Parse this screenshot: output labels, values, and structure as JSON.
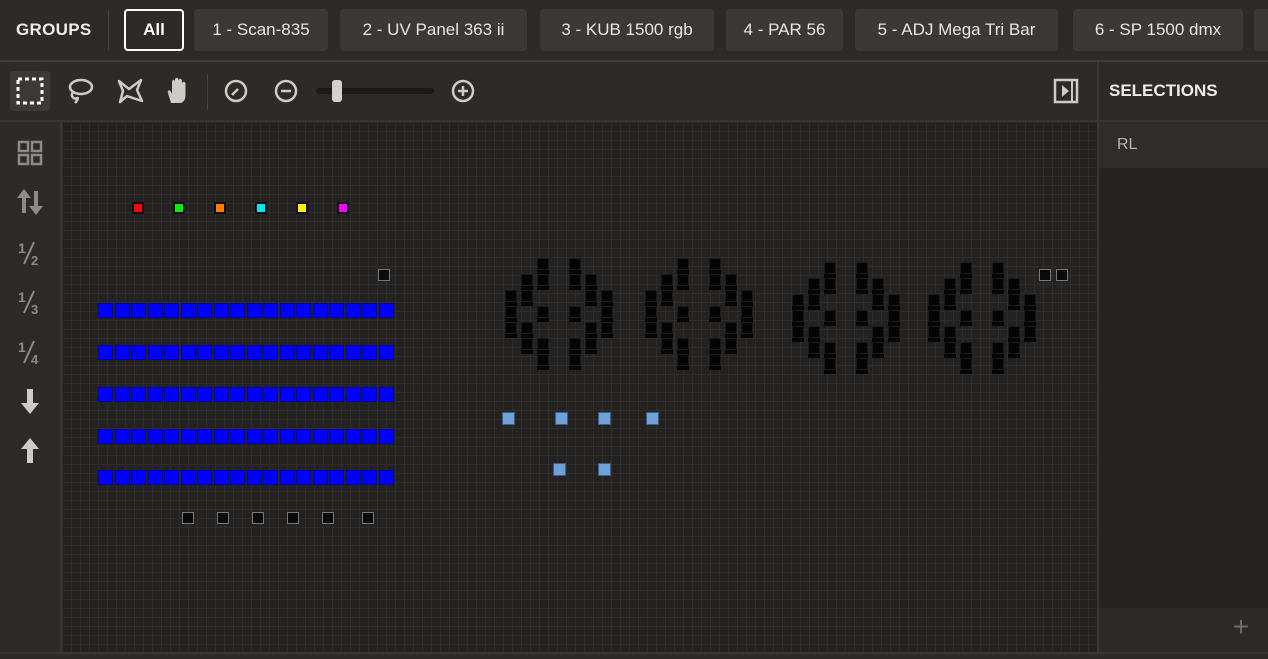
{
  "groups": {
    "label": "GROUPS",
    "items": [
      "All",
      "1 - Scan-835",
      "2 - UV Panel 363 ii",
      "3 - KUB 1500 rgb",
      "4 - PAR 56",
      "5 - ADJ Mega Tri Bar",
      "6 - SP 1500 dmx"
    ],
    "active": "All"
  },
  "toolbar": {
    "tools": [
      "rect-select-icon",
      "lasso-icon",
      "polygon-select-icon",
      "pan-hand-icon"
    ],
    "active_tool": "rect-select-icon",
    "zoom_reset": "zoom-reset-icon",
    "zoom_out": "zoom-out-icon",
    "zoom_in": "zoom-in-icon",
    "zoom_level": 0.15,
    "panel_toggle": "panel-toggle-icon"
  },
  "side_tools": [
    "grid-icon",
    "swap-vertical-icon",
    "half-icon",
    "third-icon",
    "quarter-icon",
    "arrow-down-icon",
    "arrow-up-icon"
  ],
  "selections": {
    "title": "SELECTIONS",
    "items": [
      "RL"
    ],
    "add_icon": "plus-icon"
  },
  "colors": {
    "accent_blue": "#0000ff",
    "fixture_light_blue": "#6fa0d8",
    "dots": [
      "#ff0000",
      "#00ee00",
      "#ff7a00",
      "#00e5ee",
      "#ffee00",
      "#ff00ff"
    ]
  }
}
